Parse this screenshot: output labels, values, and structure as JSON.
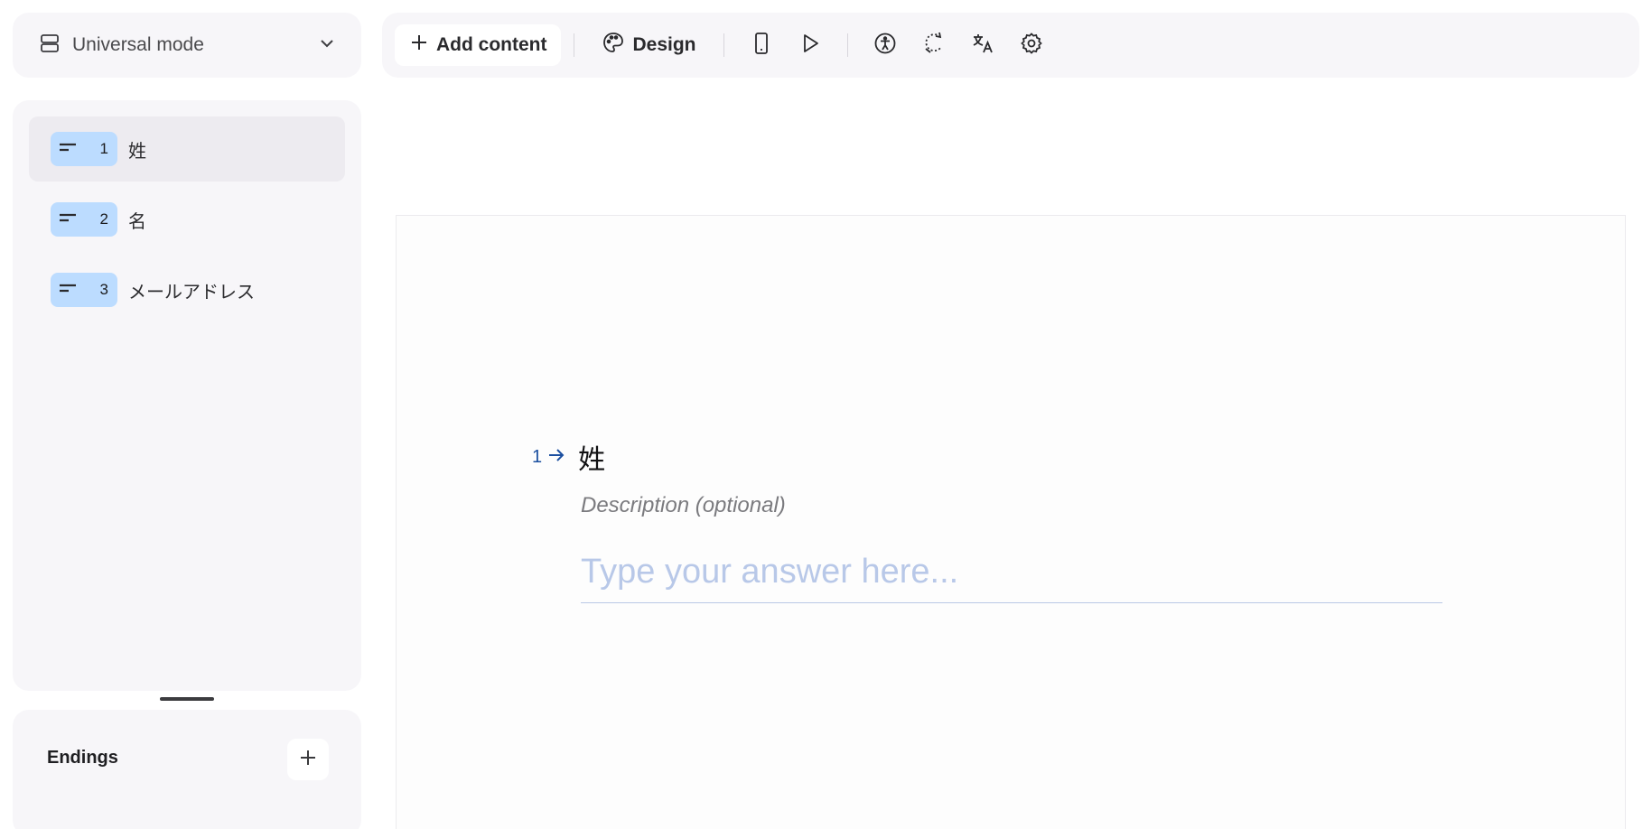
{
  "mode": {
    "label": "Universal mode"
  },
  "questions": [
    {
      "number": "1",
      "title": "姓"
    },
    {
      "number": "2",
      "title": "名"
    },
    {
      "number": "3",
      "title": "メールアドレス"
    }
  ],
  "endings": {
    "label": "Endings"
  },
  "toolbar": {
    "add_content_label": "Add content",
    "design_label": "Design"
  },
  "canvas": {
    "question_number": "1",
    "question_title": "姓",
    "description_placeholder": "Description (optional)",
    "answer_placeholder": "Type your answer here..."
  }
}
